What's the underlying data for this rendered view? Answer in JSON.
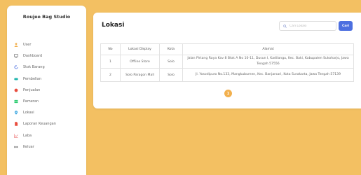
{
  "sidebar": {
    "brand": "Roujee Bag Studio",
    "items": [
      {
        "label": "User",
        "icon": "user-icon",
        "color": "#f2b04e"
      },
      {
        "label": "Dashboard",
        "icon": "monitor-icon",
        "color": "#777777"
      },
      {
        "label": "Stok Barang",
        "icon": "refresh-icon",
        "color": "#4c6fe0"
      },
      {
        "label": "Pembelian",
        "icon": "truck-icon",
        "color": "#1fb5ad"
      },
      {
        "label": "Penjualan",
        "icon": "cart-icon",
        "color": "#e84c3d"
      },
      {
        "label": "Pameran",
        "icon": "store-icon",
        "color": "#2ecc71"
      },
      {
        "label": "Lokasi",
        "icon": "map-pin-icon",
        "color": "#3aa6e0"
      },
      {
        "label": "Laporan Keuangan",
        "icon": "document-icon",
        "color": "#e84c3d"
      },
      {
        "label": "Laba",
        "icon": "chart-line-icon",
        "color": "#f08a8a"
      },
      {
        "label": "Keluar",
        "icon": "logout-icon",
        "color": "#555555"
      }
    ]
  },
  "main": {
    "title": "Lokasi",
    "search": {
      "placeholder": "Cari Lokasi",
      "value": ""
    },
    "search_button": "Cari",
    "table": {
      "headers": [
        "No",
        "Lokasi Display",
        "Kota",
        "Alamat"
      ],
      "rows": [
        [
          "1",
          "Offline Store",
          "Solo",
          "Jalan Pirtang Raya Kav 8 Blok A No 10-11, Dusun I, Kadilangu, Kec. Baki, Kabupaten Sukoharjo, Jawa Tengah 57556"
        ],
        [
          "2",
          "Solo Paragon Mall",
          "Solo",
          "Jl. Yosodipuro No.133, Mangkubumen, Kec. Banjarsari, Kota Surakarta, Jawa Tengah 57139"
        ]
      ]
    },
    "pagination": {
      "current": "1"
    }
  },
  "colors": {
    "background": "#f3c062",
    "accent": "#4c6fe0",
    "page_button": "#f2b04e"
  }
}
